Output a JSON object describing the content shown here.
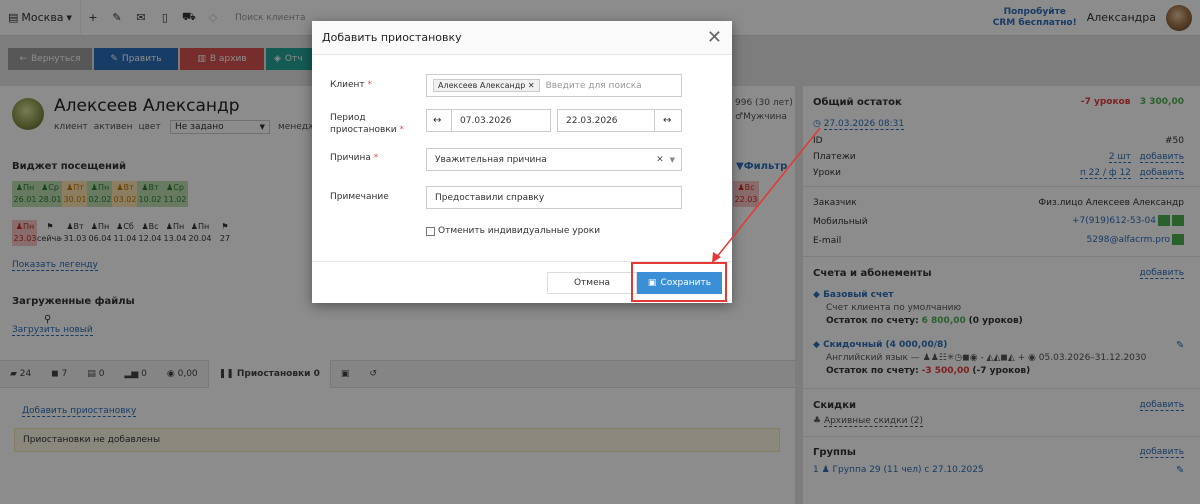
{
  "topbar": {
    "city": "Москва",
    "search_placeholder": "Поиск клиента",
    "promo_line1": "Попробуйте",
    "promo_line2": "CRM бесплатно!",
    "user_name": "Александра"
  },
  "actions": {
    "back": "Вернуться",
    "edit": "Править",
    "archive": "В архив",
    "more": "Отч"
  },
  "client": {
    "name": "Алексеев Александр",
    "tags": [
      "клиент",
      "активен",
      "цвет"
    ],
    "color_select": "Не задано",
    "manager_label": "менедж",
    "age_fragment": "996 (30 лет)",
    "gender": "Мужчина"
  },
  "visits": {
    "title": "Виджет посещений",
    "filter": "Фильтр",
    "row1": [
      {
        "d": "Пн",
        "n": "26.01",
        "c": "g"
      },
      {
        "d": "Ср",
        "n": "28.01",
        "c": "g"
      },
      {
        "d": "Пт",
        "n": "30.01",
        "c": "o"
      },
      {
        "d": "Пн",
        "n": "02.02",
        "c": "g"
      },
      {
        "d": "Вт",
        "n": "03.02",
        "c": "o"
      },
      {
        "d": "Вт",
        "n": "10.02",
        "c": "g"
      },
      {
        "d": "Ср",
        "n": "11.02",
        "c": "g"
      },
      {
        "d": "Вс",
        "n": "22.03",
        "c": "r"
      }
    ],
    "row2": [
      {
        "d": "Пн",
        "n": "23.03",
        "c": "r"
      },
      {
        "d": "",
        "n": "сейчас",
        "c": "w"
      },
      {
        "d": "Вт",
        "n": "31.03",
        "c": "w"
      },
      {
        "d": "Пн",
        "n": "06.04",
        "c": "w"
      },
      {
        "d": "Сб",
        "n": "11.04",
        "c": "w"
      },
      {
        "d": "Вс",
        "n": "12.04",
        "c": "w"
      },
      {
        "d": "Пн",
        "n": "13.04",
        "c": "w"
      },
      {
        "d": "Пн",
        "n": "20.04",
        "c": "w"
      },
      {
        "d": "",
        "n": "27",
        "c": "w"
      }
    ],
    "legend_link": "Показать легенду"
  },
  "files": {
    "title": "Загруженные файлы",
    "upload": "Загрузить новый"
  },
  "tabs": [
    "24",
    "7",
    "0",
    "0",
    "0,00",
    "Приостановки 0"
  ],
  "pauses": {
    "add_link": "Добавить приостановку",
    "empty": "Приостановки не добавлены"
  },
  "balance": {
    "title": "Общий остаток",
    "lessons": "-7 уроков",
    "amount": "3 300,00",
    "date": "27.03.2026 08:31",
    "id_label": "ID",
    "id_value": "#50",
    "payments_label": "Платежи",
    "payments_value": "2 шт",
    "lessons_label": "Уроки",
    "lessons_value": "п 22 / ф 12",
    "add": "добавить"
  },
  "contact": {
    "customer_label": "Заказчик",
    "customer_value": "Физ.лицо Алексеев Александр",
    "mobile_label": "Мобильный",
    "mobile_value": "+7(919)612-53-04",
    "email_label": "E-mail",
    "email_value": "5298@alfacrm.pro"
  },
  "accounts": {
    "title": "Счета и абонементы",
    "add": "добавить",
    "base_name": "Базовый счет",
    "base_desc": "Счет клиента по умолчанию",
    "base_balance_label": "Остаток по счету:",
    "base_balance_value": "6 800,00",
    "base_balance_extra": "(0 уроков)",
    "disc_name": "Скидочный (4 000,00/8)",
    "disc_desc": "Английский язык —",
    "disc_period": "05.03.2026–31.12.2030",
    "disc_balance_label": "Остаток по счету:",
    "disc_balance_value": "-3 500,00",
    "disc_balance_extra": "(-7 уроков)"
  },
  "discounts": {
    "title": "Скидки",
    "add": "добавить",
    "archive": "Архивные скидки (2)"
  },
  "groups": {
    "title": "Группы",
    "add": "добавить",
    "item": "Группа 29 (11 чел) с 27.10.2025"
  },
  "modal": {
    "title": "Добавить приостановку",
    "client_label": "Клиент",
    "client_chip": "Алексеев Александр",
    "client_placeholder": "Введите для поиска",
    "period_label_1": "Период",
    "period_label_2": "приостановки",
    "date_from": "07.03.2026",
    "date_to": "22.03.2026",
    "reason_label": "Причина",
    "reason_value": "Уважительная причина",
    "note_label": "Примечание",
    "note_value": "Предоставили справку",
    "checkbox_label": "Отменить индивидуальные уроки",
    "cancel": "Отмена",
    "save": "Сохранить"
  },
  "colors": {
    "primary": "#3a8fd6",
    "danger": "#e53935",
    "green": "#4caf50"
  }
}
